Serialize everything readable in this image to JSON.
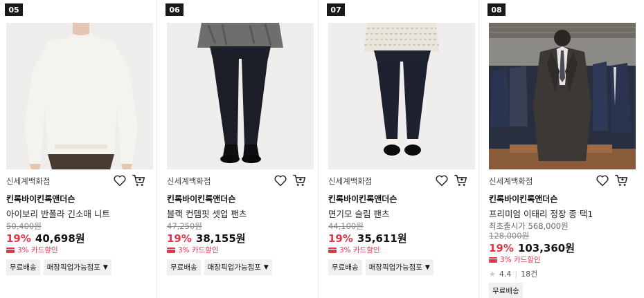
{
  "products": [
    {
      "rank": "05",
      "store": "신세계백화점",
      "brand": "킨록바이킨록앤더슨",
      "name": "아이보리 반폴라 긴소매 니트",
      "original_price": "50,400원",
      "discount": "19%",
      "price": "40,698원",
      "card_discount": "3% 카드할인",
      "tags": [
        "무료배송",
        "매장픽업가능점포"
      ],
      "image": "ivory-knit-model"
    },
    {
      "rank": "06",
      "store": "신세계백화점",
      "brand": "킨록바이킨록앤더슨",
      "name": "블랙 컨템핏 셋업 팬츠",
      "original_price": "47,250원",
      "discount": "19%",
      "price": "38,155원",
      "card_discount": "3% 카드할인",
      "tags": [
        "무료배송",
        "매장픽업가능점포"
      ],
      "image": "black-slacks-model"
    },
    {
      "rank": "07",
      "store": "신세계백화점",
      "brand": "킨록바이킨록앤더슨",
      "name": "면기모 슬림 팬츠",
      "original_price": "44,100원",
      "discount": "19%",
      "price": "35,611원",
      "card_discount": "3% 카드할인",
      "tags": [
        "무료배송",
        "매장픽업가능점포"
      ],
      "image": "navy-pants-model"
    },
    {
      "rank": "08",
      "store": "신세계백화점",
      "brand": "킨록바이킨록앤더슨",
      "name": "프리미엄 이태리 정장 종 택1",
      "lowest_price_label": "최초출시가 568,000원",
      "original_price": "128,000원",
      "discount": "19%",
      "price": "103,360원",
      "card_discount": "3% 카드할인",
      "rating": "4.4",
      "review_count": "18건",
      "tags": [
        "무료배송"
      ],
      "image": "suit-store-display"
    }
  ],
  "icons": {
    "wishlist": "heart-icon",
    "cart": "cart-icon",
    "card": "credit-card-icon",
    "dropdown": "caret-down-icon",
    "star": "star-icon"
  },
  "colors": {
    "discount": "#e4334a",
    "rank_badge": "#1a1a1a",
    "tag_bg": "#f0f0f0"
  }
}
